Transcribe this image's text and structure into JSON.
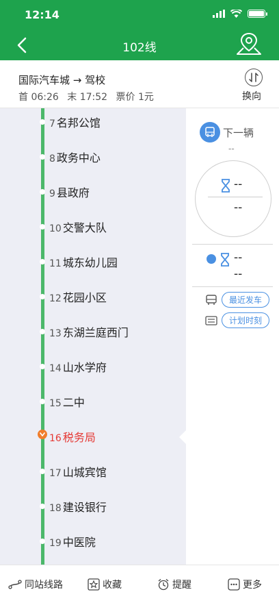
{
  "status": {
    "time": "12:14"
  },
  "nav": {
    "title": "102线"
  },
  "route": {
    "name": "国际汽车城 → 驾校",
    "first": "首 06:26",
    "last": "末 17:52",
    "fare": "票价 1元",
    "switch_label": "换向"
  },
  "stations": [
    {
      "num": "7",
      "name": "名邦公馆"
    },
    {
      "num": "8",
      "name": "政务中心"
    },
    {
      "num": "9",
      "name": "县政府"
    },
    {
      "num": "10",
      "name": "交警大队"
    },
    {
      "num": "11",
      "name": "城东幼儿园"
    },
    {
      "num": "12",
      "name": "花园小区"
    },
    {
      "num": "13",
      "name": "东湖兰庭西门"
    },
    {
      "num": "14",
      "name": "山水学府"
    },
    {
      "num": "15",
      "name": "二中"
    },
    {
      "num": "16",
      "name": "税务局"
    },
    {
      "num": "17",
      "name": "山城宾馆"
    },
    {
      "num": "18",
      "name": "建设银行"
    },
    {
      "num": "19",
      "name": "中医院"
    }
  ],
  "panel": {
    "next_label": "下一辆",
    "next_sub": "--",
    "eta1": "--",
    "eta1_sub": "--",
    "eta2": "--",
    "eta2_sub": "--",
    "latest_depart": "最近发车",
    "schedule": "计划时刻"
  },
  "tabs": {
    "same_station": "同站线路",
    "favorite": "收藏",
    "remind": "提醒",
    "more": "更多"
  },
  "colors": {
    "header": "#1ea34d",
    "line": "#4cb86a",
    "current": "#e53935",
    "accent": "#4a90e2"
  }
}
